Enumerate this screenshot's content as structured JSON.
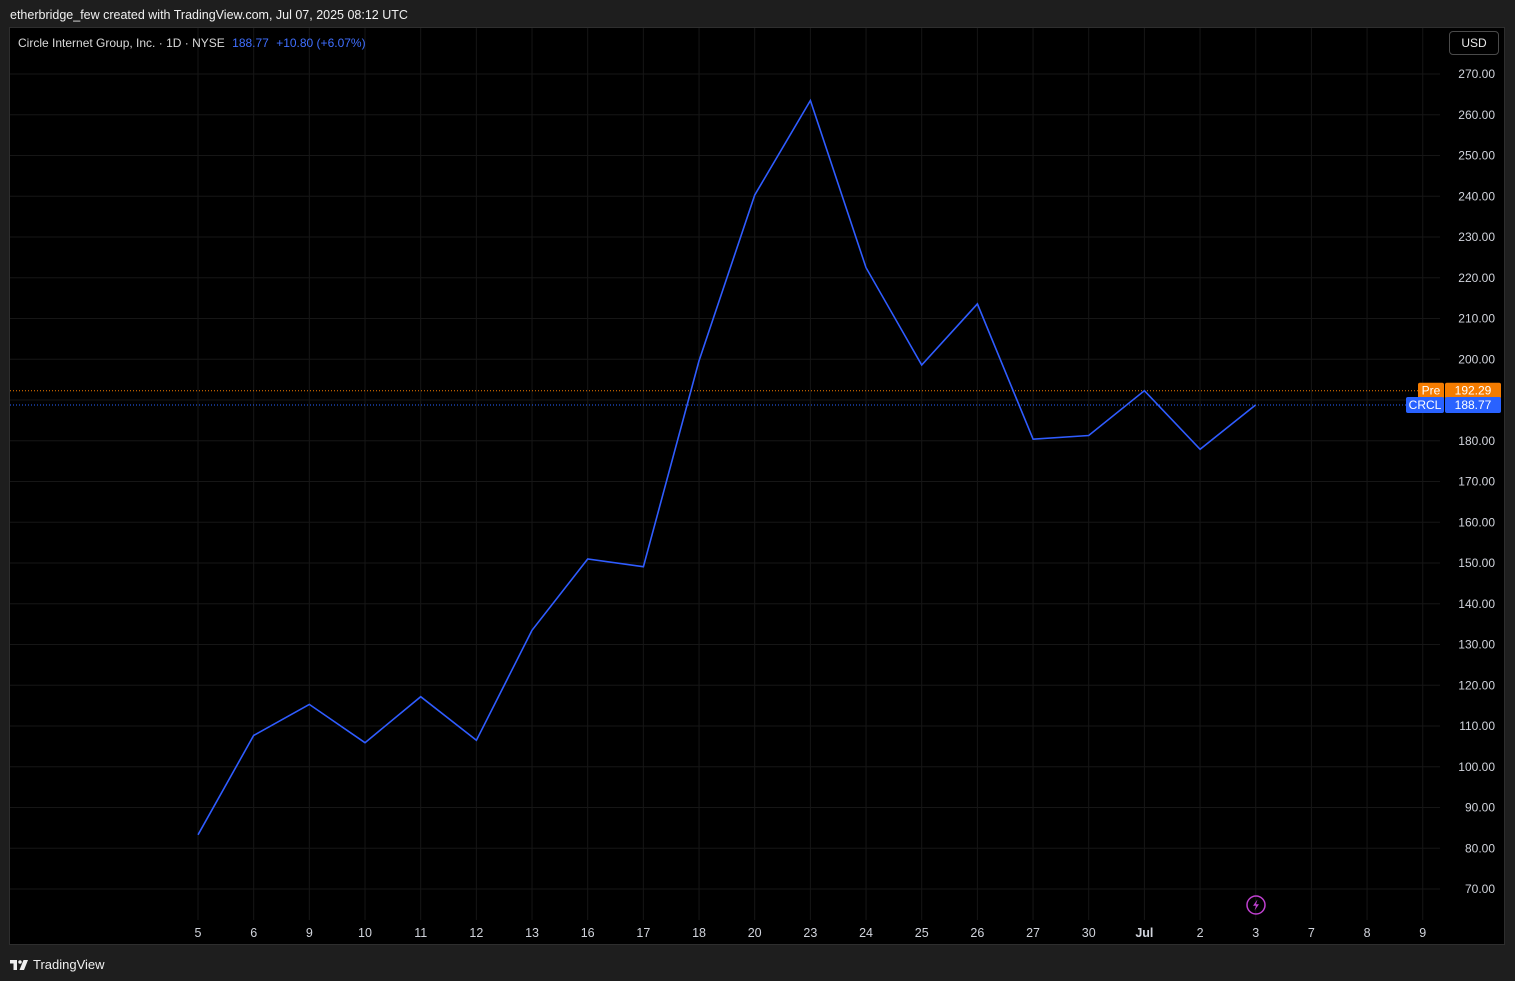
{
  "header": {
    "attribution": "etherbridge_few created with TradingView.com, Jul 07, 2025 08:12 UTC"
  },
  "legend": {
    "symbol_name": "Circle Internet Group, Inc.",
    "interval": "1D",
    "exchange": "NYSE",
    "last_price": "188.77",
    "change": "+10.80 (+6.07%)"
  },
  "toolbar": {
    "currency_label": "USD"
  },
  "footer": {
    "brand": "TradingView"
  },
  "colors": {
    "line": "#2f5cff",
    "pre_market": "#f57c00",
    "price_tag": "#2962ff",
    "grid": "#161616",
    "axis_text": "#d1d4dc",
    "lightning": "#c040d0"
  },
  "chart_data": {
    "type": "line",
    "x": [
      "5",
      "6",
      "9",
      "10",
      "11",
      "12",
      "13",
      "16",
      "17",
      "18",
      "20",
      "23",
      "24",
      "25",
      "26",
      "27",
      "30",
      "Jul",
      "2",
      "3"
    ],
    "values": [
      83.3,
      107.7,
      115.3,
      105.9,
      117.2,
      106.5,
      133.5,
      151.0,
      149.1,
      199.6,
      240.3,
      263.5,
      222.5,
      198.6,
      213.6,
      180.4,
      181.3,
      192.3,
      177.9,
      188.8
    ],
    "x_ticks": [
      "5",
      "6",
      "9",
      "10",
      "11",
      "12",
      "13",
      "16",
      "17",
      "18",
      "20",
      "23",
      "24",
      "25",
      "26",
      "27",
      "30",
      "Jul",
      "2",
      "3",
      "7",
      "8",
      "9"
    ],
    "bold_ticks": [
      "Jul"
    ],
    "y_ticks": [
      70,
      80,
      90,
      100,
      110,
      120,
      130,
      140,
      150,
      160,
      170,
      180,
      190,
      200,
      210,
      220,
      230,
      240,
      250,
      260,
      270
    ],
    "y_tick_labels_hidden": [
      190
    ],
    "ylim": [
      62.4,
      281.3
    ],
    "grid": true,
    "price_lines": [
      {
        "label": "Pre",
        "value": 192.29,
        "text": "192.29",
        "color": "#f57c00"
      },
      {
        "label": "CRCL",
        "value": 188.77,
        "text": "188.77",
        "color": "#2962ff"
      }
    ]
  }
}
